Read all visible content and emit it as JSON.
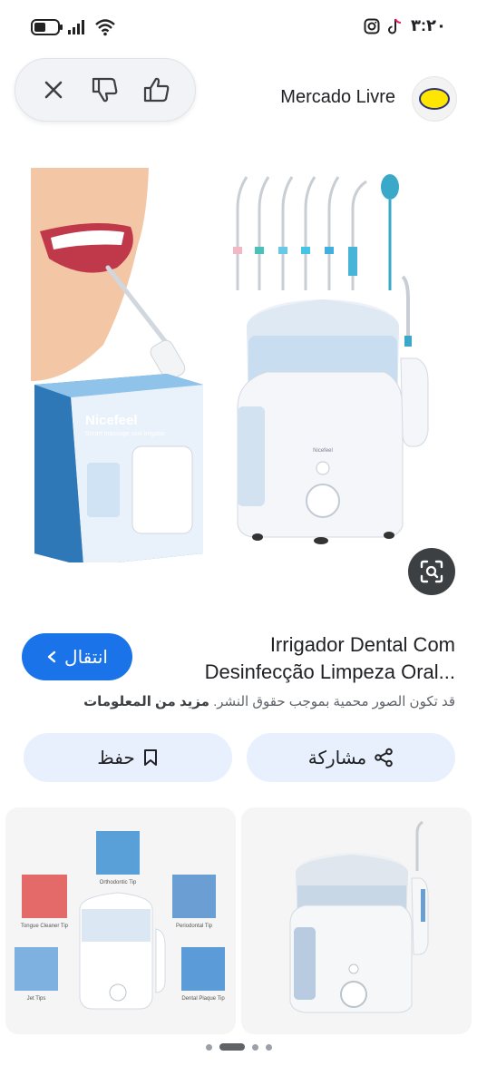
{
  "status_bar": {
    "time": "٣:٢٠"
  },
  "source": {
    "name": "Mercado Livre"
  },
  "product": {
    "title_line1": "Irrigador Dental Com",
    "title_line2": "Desinfecção Limpeza Oral...",
    "box_brand": "Nicefeel",
    "box_subtitle": "Smart massage oral irrigator",
    "device_brand": "Nicefeel"
  },
  "visit_button": {
    "label": "انتقال"
  },
  "copyright": {
    "text": "قد تكون الصور محمية بموجب حقوق النشر.",
    "more": "مزيد من المعلومات"
  },
  "actions": {
    "share_label": "مشاركة",
    "save_label": "حفظ"
  },
  "related": {
    "card1_labels": [
      "Orthodontic Tip",
      "Tongue Cleaner Tip",
      "Periodontal Tip",
      "Jet Tips",
      "Dental Plaque Tip"
    ]
  },
  "colors": {
    "accent": "#1a73e8",
    "chip_bg": "#e8f0fe"
  },
  "icons": [
    "battery-icon",
    "signal-icon",
    "wifi-icon",
    "instagram-icon",
    "tiktok-icon",
    "close-icon",
    "thumbs-down-icon",
    "thumbs-up-icon",
    "lens-icon",
    "share-icon",
    "bookmark-icon",
    "chevron-icon"
  ]
}
